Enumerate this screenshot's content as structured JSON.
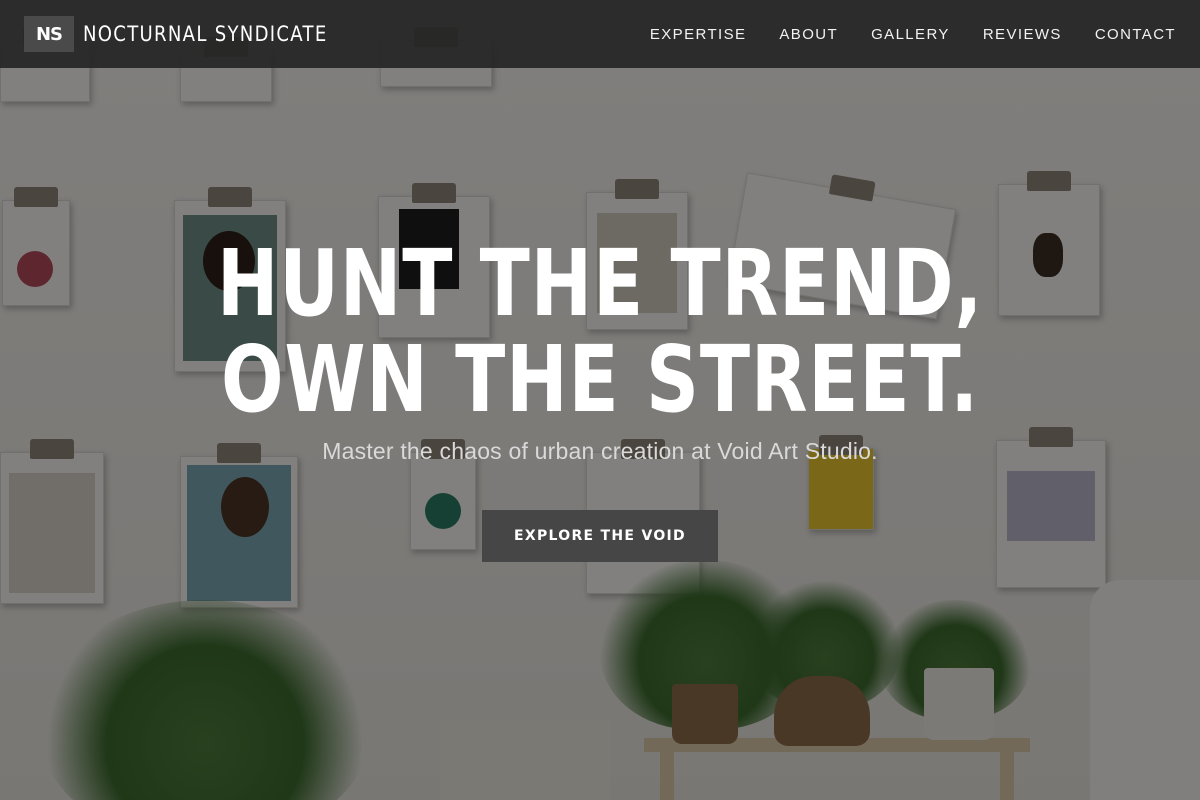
{
  "brand": {
    "logo_text": "NS",
    "name": "NOCTURNAL SYNDICATE"
  },
  "nav": {
    "items": [
      "EXPERTISE",
      "ABOUT",
      "GALLERY",
      "REVIEWS",
      "CONTACT"
    ]
  },
  "hero": {
    "title_line1": "HUNT THE TREND,",
    "title_line2": "OWN THE STREET.",
    "subtitle": "Master the chaos of urban creation at Void Art Studio.",
    "cta_label": "EXPLORE THE VOID",
    "background_image": "wall-of-clipboards-with-plants"
  },
  "colors": {
    "navbar_bg": "#262626",
    "logo_bg": "#4a4a4a",
    "cta_bg": "#464646",
    "text_primary": "#ffffff",
    "text_secondary": "#d9d9d9"
  }
}
